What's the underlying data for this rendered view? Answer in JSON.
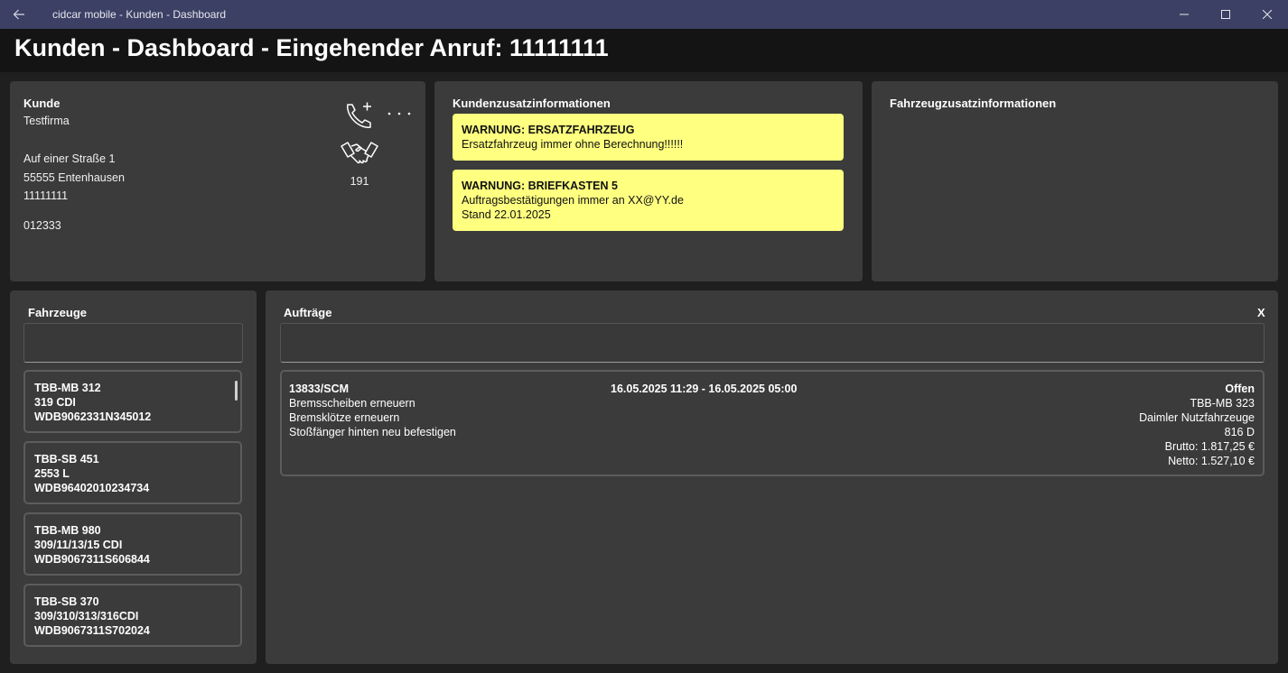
{
  "window": {
    "title": "cidcar mobile - Kunden - Dashboard"
  },
  "page": {
    "title": "Kunden - Dashboard - Eingehender Anruf: 11111111"
  },
  "customer": {
    "heading": "Kunde",
    "name": "Testfirma",
    "street": "Auf einer Straße 1",
    "city": "55555 Entenhausen",
    "phone": "11111111",
    "number": "012333",
    "handshake_count": "191",
    "icons": [
      "phone-add-icon",
      "more-icon",
      "handshake-icon"
    ]
  },
  "customer_info": {
    "heading": "Kundenzusatzinformationen",
    "warnings": [
      {
        "title": "WARNUNG: ERSATZFAHRZEUG",
        "lines": [
          "Ersatzfahrzeug immer ohne Berechnung!!!!!!"
        ]
      },
      {
        "title": "WARNUNG: BRIEFKASTEN 5",
        "lines": [
          "Auftragsbestätigungen immer an XX@YY.de",
          "Stand 22.01.2025"
        ]
      }
    ],
    "warning_color": "#ffff80"
  },
  "vehicle_info": {
    "heading": "Fahrzeugzusatzinformationen"
  },
  "vehicles": {
    "heading": "Fahrzeuge",
    "search_value": "",
    "items": [
      {
        "plate": "TBB-MB 312",
        "model": "319 CDI",
        "vin": "WDB9062331N345012"
      },
      {
        "plate": "TBB-SB 451",
        "model": "2553 L",
        "vin": "WDB96402010234734"
      },
      {
        "plate": "TBB-MB 980",
        "model": "309/11/13/15 CDI",
        "vin": "WDB9067311S606844"
      },
      {
        "plate": "TBB-SB 370",
        "model": "309/310/313/316CDI",
        "vin": "WDB9067311S702024"
      }
    ]
  },
  "orders": {
    "heading": "Aufträge",
    "close_label": "X",
    "search_value": "",
    "items": [
      {
        "number": "13833/SCM",
        "period": "16.05.2025 11:29 - 16.05.2025 05:00",
        "status": "Offen",
        "tasks": [
          "Bremsscheiben erneuern",
          "Bremsklötze erneuern",
          "Stoßfänger hinten neu befestigen"
        ],
        "plate": "TBB-MB 323",
        "make": "Daimler Nutzfahrzeuge",
        "model": "816 D",
        "gross": "Brutto: 1.817,25 €",
        "net": "Netto: 1.527,10 €"
      }
    ]
  },
  "colors": {
    "titlebar": "#3c4064",
    "header": "#141414",
    "background": "#1f1f1f",
    "panel": "#3b3b3b"
  }
}
